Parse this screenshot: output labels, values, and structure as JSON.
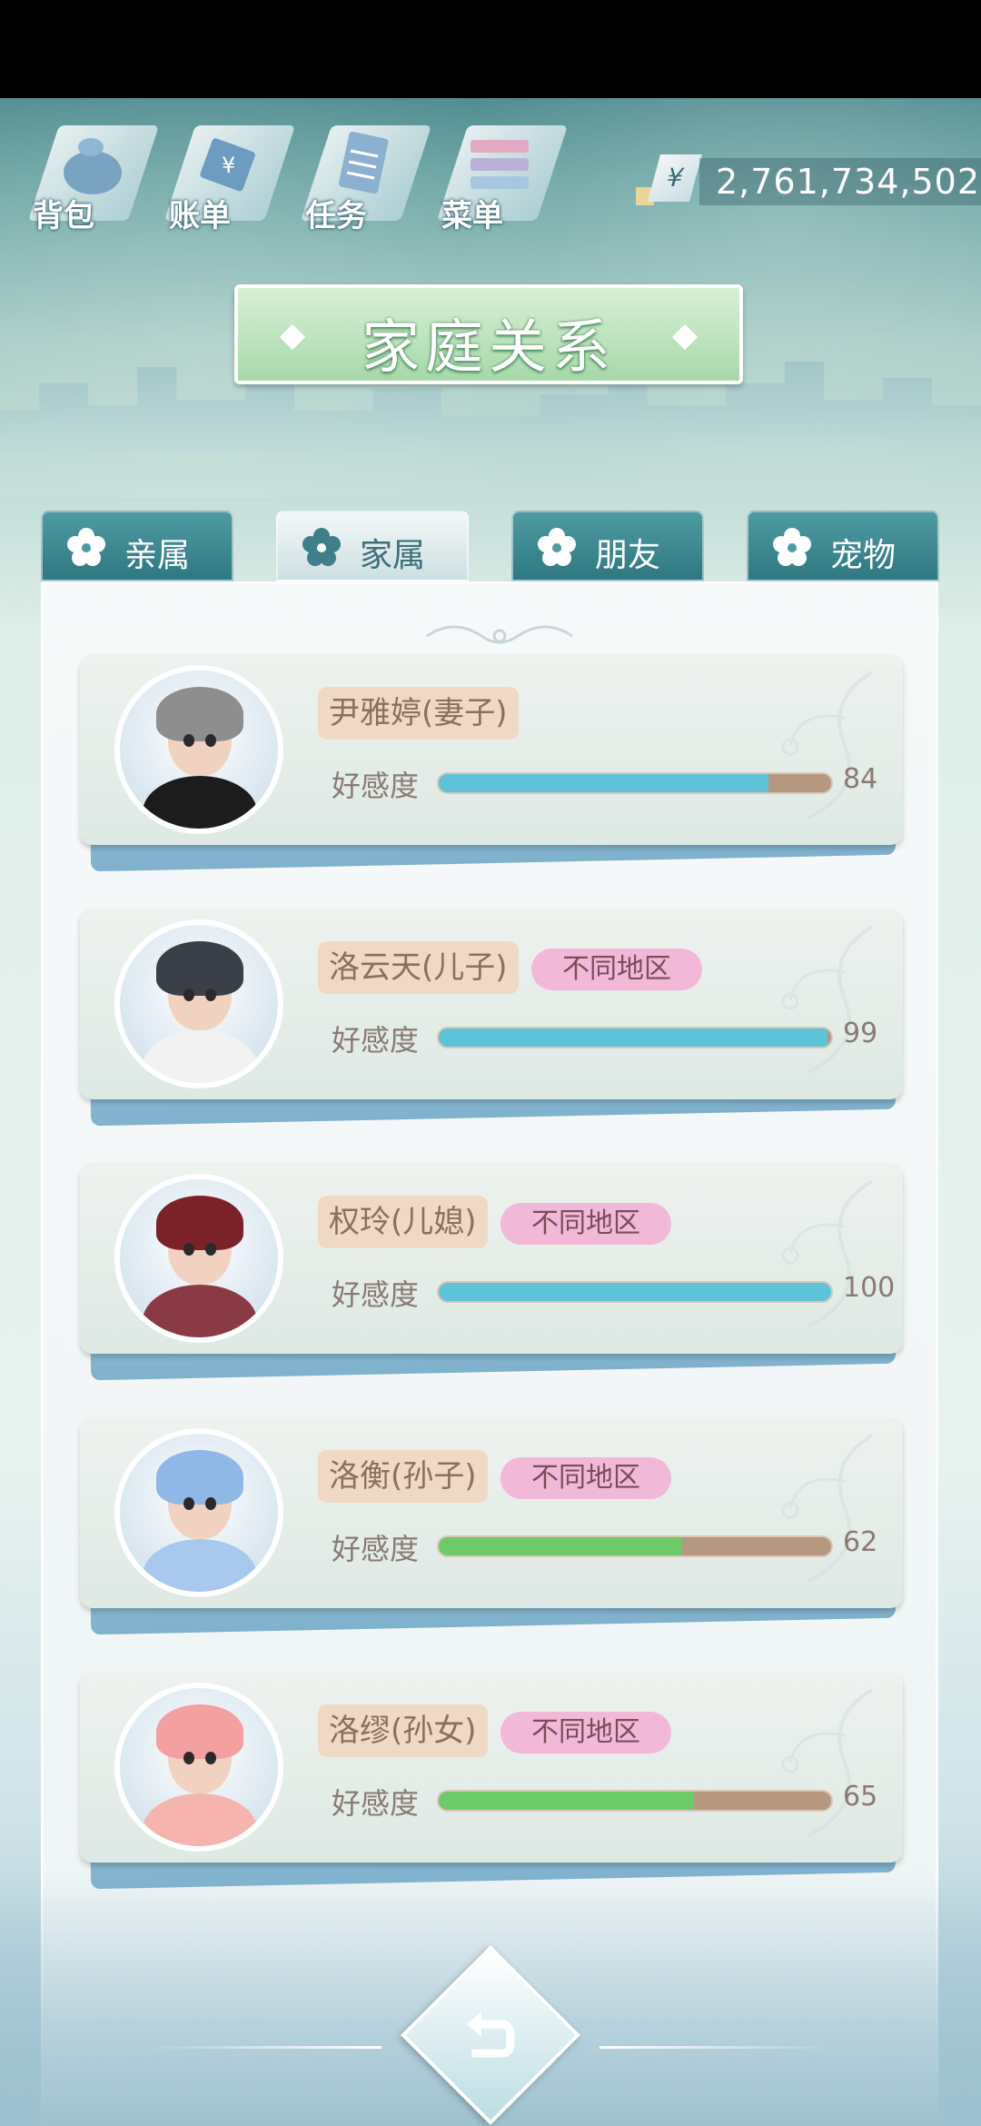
{
  "topbar": {
    "items": [
      {
        "label": "背包",
        "icon": "bag-icon"
      },
      {
        "label": "账单",
        "icon": "bill-icon"
      },
      {
        "label": "任务",
        "icon": "task-icon"
      },
      {
        "label": "菜单",
        "icon": "menu-icon"
      }
    ],
    "currency": {
      "symbol": "¥",
      "amount": "2,761,734,502"
    }
  },
  "title": "家庭关系",
  "tabs": [
    {
      "label": "亲属",
      "active": false
    },
    {
      "label": "家属",
      "active": true
    },
    {
      "label": "朋友",
      "active": false
    },
    {
      "label": "宠物",
      "active": false
    }
  ],
  "affinity_label": "好感度",
  "members": [
    {
      "name": "尹雅婷(妻子)",
      "region": "",
      "affinity": 84,
      "affinity_text": "84",
      "bar_color": "#5cc3d9",
      "hair_color": "#8e8e8e",
      "shirt_color": "#1c1c1c"
    },
    {
      "name": "洛云天(儿子)",
      "region": "不同地区",
      "affinity": 99,
      "affinity_text": "99",
      "bar_color": "#5cc3d9",
      "hair_color": "#3a3f48",
      "shirt_color": "#f2f2f2"
    },
    {
      "name": "权玲(儿媳)",
      "region": "不同地区",
      "affinity": 100,
      "affinity_text": "100",
      "bar_color": "#5cc3d9",
      "hair_color": "#7a2228",
      "shirt_color": "#8a3a44"
    },
    {
      "name": "洛衡(孙子)",
      "region": "不同地区",
      "affinity": 62,
      "affinity_text": "62",
      "bar_color": "#6ccb68",
      "hair_color": "#8fb8e6",
      "shirt_color": "#a9c8ee"
    },
    {
      "name": "洛缪(孙女)",
      "region": "不同地区",
      "affinity": 65,
      "affinity_text": "65",
      "bar_color": "#6ccb68",
      "hair_color": "#f2a0a0",
      "shirt_color": "#f5b4ad"
    }
  ],
  "back_button": {
    "icon": "return-icon"
  }
}
